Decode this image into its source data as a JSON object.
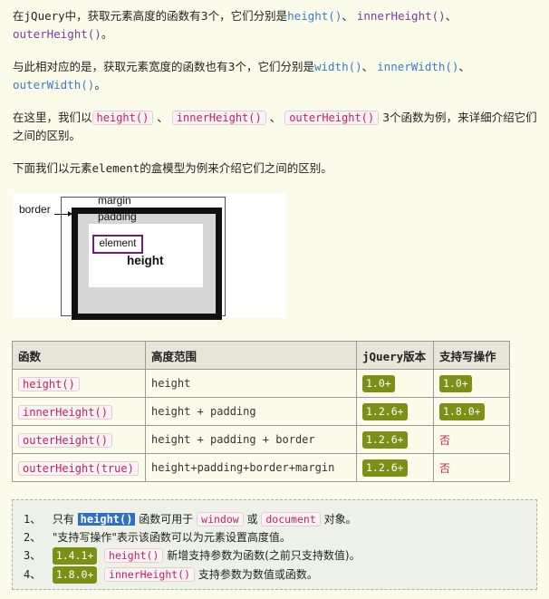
{
  "intro": {
    "p1_prefix": "在",
    "p1_jquery": "jQuery",
    "p1_mid": "中，获取元素高度的函数有3个，它们分别是",
    "p1_f1": "height()",
    "p1_sep1": "、 ",
    "p1_f2": "innerHeight()",
    "p1_sep2": "、",
    "p1_f3": "outerHeight()",
    "p1_end": "。",
    "p2_mid": "与此相对应的是，获取元素宽度的函数也有3个，它们分别是",
    "p2_f1": "width()",
    "p2_sep1": "、 ",
    "p2_f2": "innerWidth()",
    "p2_sep2": "、",
    "p2_f3": "outerWidth()",
    "p2_end": "。",
    "p3_prefix": "在这里，我们以",
    "p3_c1": "height()",
    "p3_sep": "、",
    "p3_c2": "innerHeight()",
    "p3_c3": "outerHeight()",
    "p3_end": "3个函数为例，来详细介绍它们之间的区别。",
    "p4_prefix": "下面我们以元素",
    "p4_el": "element",
    "p4_end": "的盒模型为例来介绍它们之间的区别。"
  },
  "diagram": {
    "border": "border",
    "margin": "margin",
    "padding": "padding",
    "element": "element",
    "height": "height"
  },
  "table": {
    "headers": [
      "函数",
      "高度范围",
      "jQuery版本",
      "支持写操作"
    ],
    "rows": [
      {
        "fn": "height()",
        "range": "height",
        "version": "1.0+",
        "write": "1.0+"
      },
      {
        "fn": "innerHeight()",
        "range": "height + padding",
        "version": "1.2.6+",
        "write": "1.8.0+"
      },
      {
        "fn": "outerHeight()",
        "range": "height + padding + border",
        "version": "1.2.6+",
        "write": "否"
      },
      {
        "fn": "outerHeight(true)",
        "range": "height+padding+border+margin",
        "version": "1.2.6+",
        "write": "否"
      }
    ]
  },
  "notes": {
    "n1_num": "1、",
    "n1_a": "只有",
    "n1_hl": "height()",
    "n1_b": "函数可用于",
    "n1_c1": "window",
    "n1_or": "或",
    "n1_c2": "document",
    "n1_end": "对象。",
    "n2_num": "2、",
    "n2_text": "\"支持写操作\"表示该函数可以为元素设置高度值。",
    "n3_num": "3、",
    "n3_badge": "1.4.1+",
    "n3_code": "height()",
    "n3_text": "新增支持参数为函数(之前只支持数值)。",
    "n4_num": "4、",
    "n4_badge": "1.8.0+",
    "n4_code": "innerHeight()",
    "n4_text": "支持参数为数值或函数。"
  },
  "colors": {
    "page_bg": "#fbfbe9",
    "badge": "#7c8f16",
    "code_text": "#c0245d",
    "link_blue": "#3a7bc8",
    "purple": "#7a3aa6",
    "highlight": "#2f6fc6"
  }
}
